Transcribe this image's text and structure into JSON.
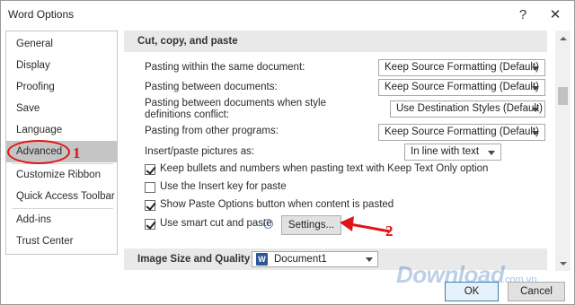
{
  "window": {
    "title": "Word Options",
    "help_glyph": "?",
    "close_glyph": "✕"
  },
  "sidebar": {
    "items": [
      {
        "label": "General"
      },
      {
        "label": "Display"
      },
      {
        "label": "Proofing"
      },
      {
        "label": "Save"
      },
      {
        "label": "Language"
      },
      {
        "label": "Advanced",
        "selected": true
      },
      {
        "label": "Customize Ribbon"
      },
      {
        "label": "Quick Access Toolbar"
      },
      {
        "label": "Add-ins"
      },
      {
        "label": "Trust Center"
      }
    ]
  },
  "annotations": {
    "step1": "1",
    "step2": "2",
    "color": "#e01414"
  },
  "cut_copy_paste": {
    "header": "Cut, copy, and paste",
    "rows": [
      {
        "label": "Pasting within the same document:",
        "value": "Keep Source Formatting (Default)"
      },
      {
        "label": "Pasting between documents:",
        "value": "Keep Source Formatting (Default)"
      },
      {
        "label": "Pasting between documents when style definitions conflict:",
        "value": "Use Destination Styles (Default)"
      },
      {
        "label": "Pasting from other programs:",
        "value": "Keep Source Formatting (Default)"
      },
      {
        "label": "Insert/paste pictures as:",
        "value": "In line with text"
      }
    ],
    "checkboxes": [
      {
        "label": "Keep bullets and numbers when pasting text with Keep Text Only option",
        "checked": true
      },
      {
        "label": "Use the Insert key for paste",
        "checked": false
      },
      {
        "label": "Show Paste Options button when content is pasted",
        "checked": true
      },
      {
        "label": "Use smart cut and paste",
        "checked": true
      }
    ],
    "info_glyph": "i",
    "settings_button": "Settings..."
  },
  "image_size_quality": {
    "header": "Image Size and Quality",
    "document": "Document1",
    "doc_icon": "W"
  },
  "footer": {
    "ok": "OK",
    "cancel": "Cancel"
  },
  "watermark": {
    "main": "Download",
    "sub": ".com.vn"
  },
  "colors": {
    "selected_nav": "#c5c5c5",
    "section_header": "#e9e9e9",
    "ok_border": "#3c7fb1"
  }
}
